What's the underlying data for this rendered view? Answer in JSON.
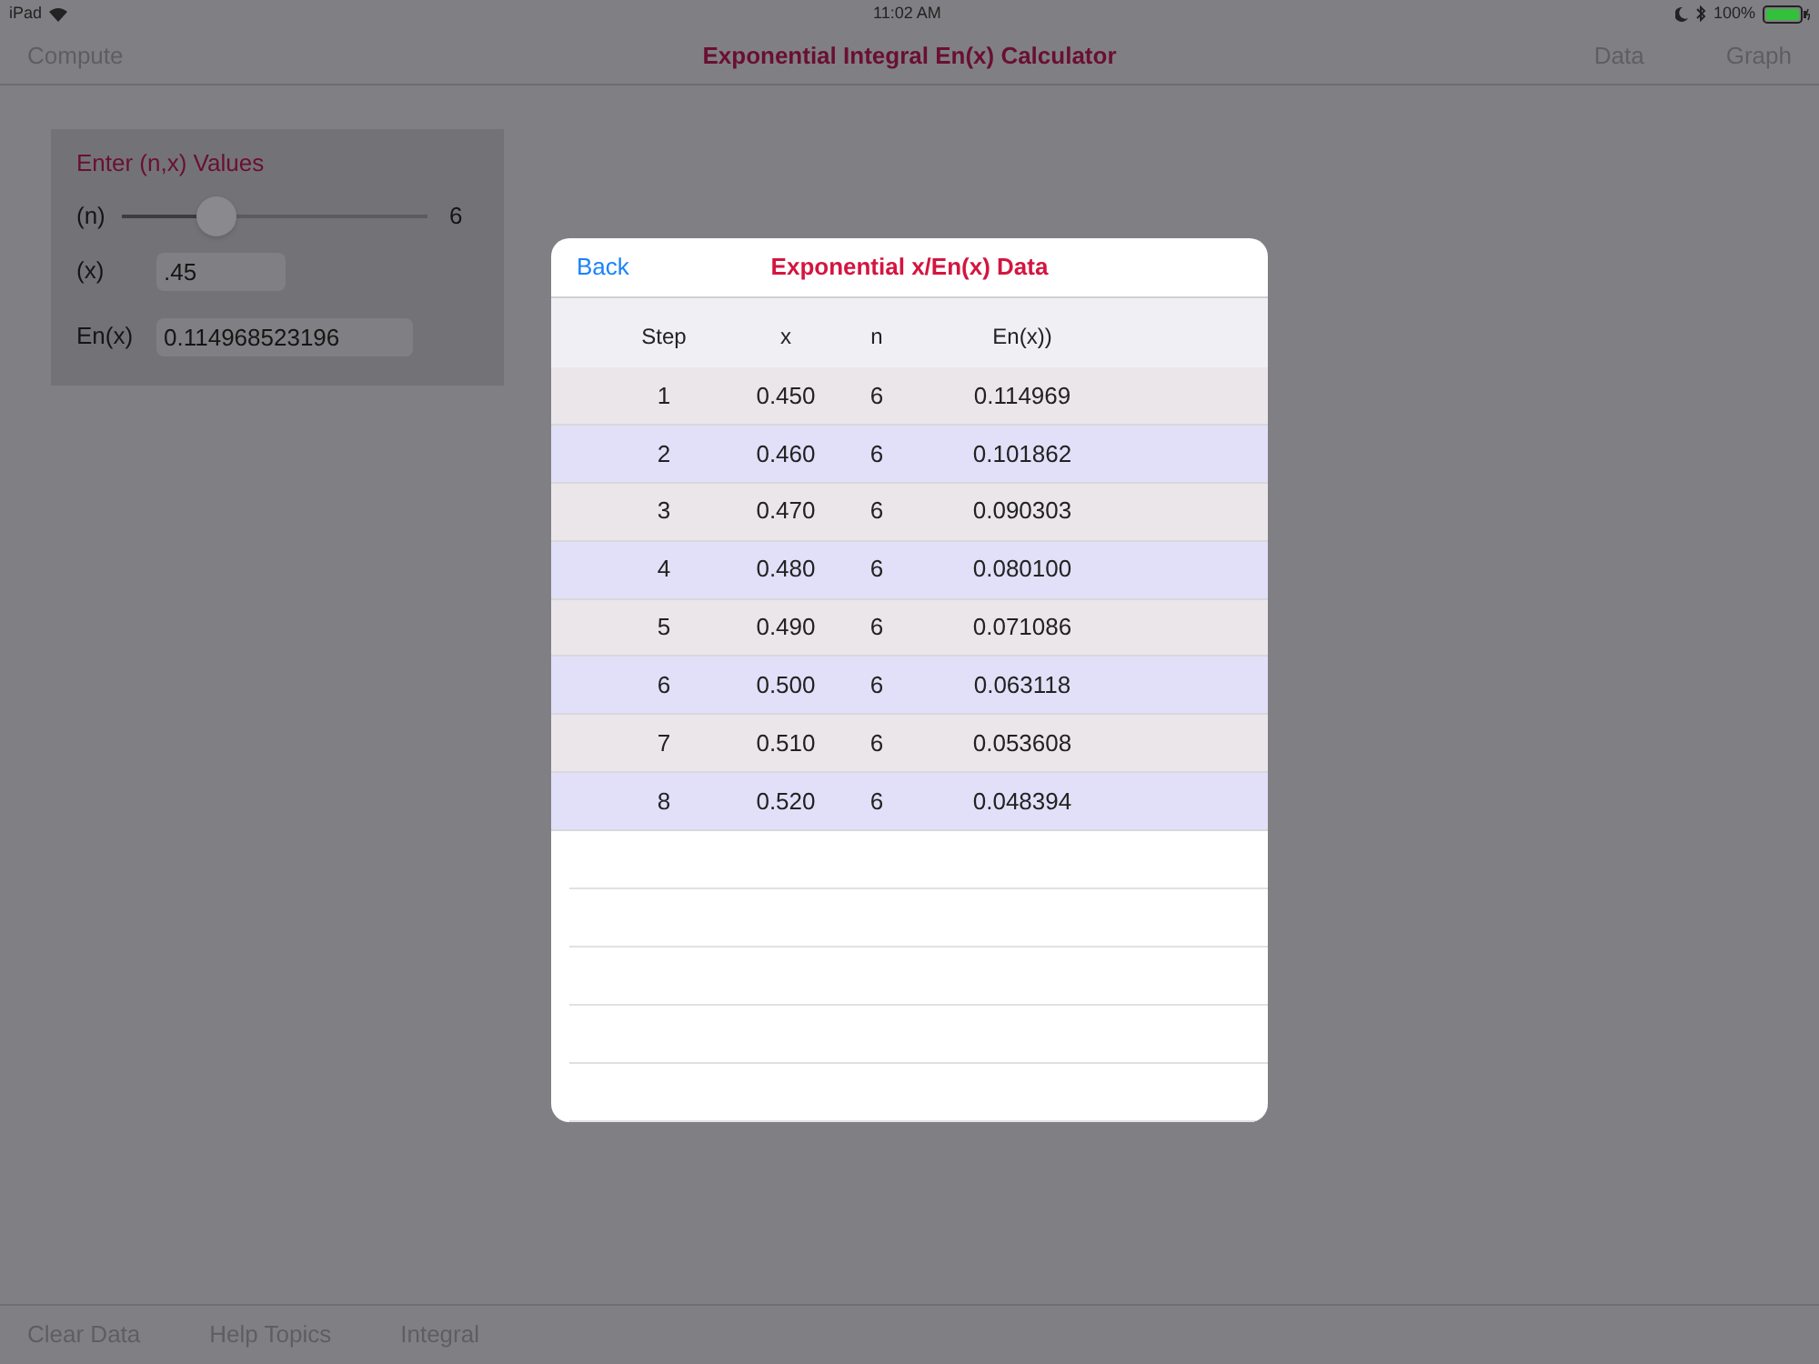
{
  "status_bar": {
    "device": "iPad",
    "time": "11:02 AM",
    "battery": "100%"
  },
  "nav": {
    "left": "Compute",
    "title": "Exponential Integral En(x) Calculator",
    "right": [
      "Data",
      "Graph"
    ]
  },
  "panel": {
    "title": "Enter (n,x) Values",
    "n_label": "(n)",
    "slider": {
      "level": 0.31
    },
    "n_value": "6",
    "x_label": "(x)",
    "x_value": ".45",
    "en_label": "En(x)",
    "en_value": "0.114968523196"
  },
  "modal": {
    "back": "Back",
    "title": "Exponential x/En(x) Data",
    "columns": [
      "Step",
      "x",
      "n",
      "En(x))"
    ],
    "rows": [
      [
        "1",
        "0.450",
        "6",
        "0.114969"
      ],
      [
        "2",
        "0.460",
        "6",
        "0.101862"
      ],
      [
        "3",
        "0.470",
        "6",
        "0.090303"
      ],
      [
        "4",
        "0.480",
        "6",
        "0.080100"
      ],
      [
        "5",
        "0.490",
        "6",
        "0.071086"
      ],
      [
        "6",
        "0.500",
        "6",
        "0.063118"
      ],
      [
        "7",
        "0.510",
        "6",
        "0.053608"
      ],
      [
        "8",
        "0.520",
        "6",
        "0.048394"
      ]
    ]
  },
  "toolbar": [
    "Clear Data",
    "Help Topics",
    "Integral"
  ]
}
